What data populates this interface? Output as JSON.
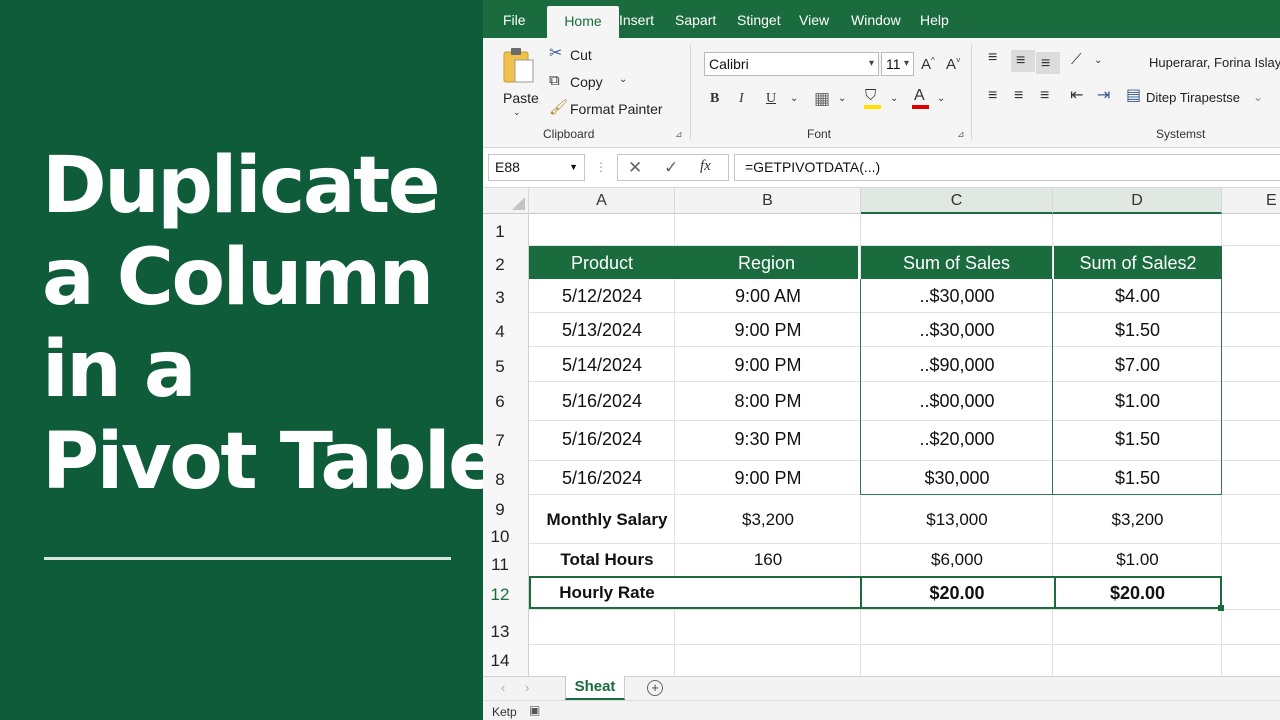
{
  "left_panel": {
    "title_lines": [
      "Duplicate",
      "a Column",
      "in a",
      "Pivot Table"
    ],
    "background_color": "#0e5c3a"
  },
  "menubar": {
    "tabs": [
      "File",
      "Home",
      "Insert",
      "Sapart",
      "Stinget",
      "View",
      "Window",
      "Help"
    ],
    "active_tab": "Home",
    "accent_color": "#1a6b3d"
  },
  "ribbon": {
    "clipboard": {
      "paste_label": "Paste",
      "cut_label": "Cut",
      "copy_label": "Copy",
      "format_painter_label": "Format Painter",
      "group_label": "Clipboard"
    },
    "font": {
      "font_name": "Calibri",
      "font_size": "11",
      "group_label": "Font",
      "grow_font": "A",
      "shrink_font": "A",
      "bold": "B",
      "italic": "I",
      "underline": "U",
      "font_color_glyph": "A",
      "highlight_color": "#ffe000",
      "font_color": "#e00000"
    },
    "alignment": {
      "wrap_text_label": "Huperarar, Forina Islay",
      "merge_label": "Ditep Tirapestse",
      "group_label": "Systemst"
    }
  },
  "formula_bar": {
    "name_box": "E88",
    "fx_label": "fx",
    "formula": "=GETPIVOTDATA(...)"
  },
  "grid": {
    "column_headers": [
      "A",
      "B",
      "C",
      "D",
      "E"
    ],
    "selected_columns": [
      "C",
      "D"
    ],
    "row_numbers": [
      "1",
      "2",
      "3",
      "4",
      "5",
      "6",
      "7",
      "8",
      "9",
      "10",
      "11",
      "12",
      "13",
      "14"
    ],
    "selected_row": "12",
    "pivot_headers": [
      "Product",
      "Region",
      "Sum of Sales",
      "Sum of Sales2"
    ],
    "pivot_rows": [
      [
        "5/12/2024",
        "9:00 AM",
        "..$30,000",
        "$4.00"
      ],
      [
        "5/13/2024",
        "9:00 PM",
        "..$30,000",
        "$1.50"
      ],
      [
        "5/14/2024",
        "9:00 PM",
        "..$90,000",
        "$7.00"
      ],
      [
        "5/16/2024",
        "8:00 PM",
        "..$00,000",
        "$1.00"
      ],
      [
        "5/16/2024",
        "9:30 PM",
        "..$20,000",
        "$1.50"
      ],
      [
        "5/16/2024",
        "9:00 PM",
        "$30,000",
        "$1.50"
      ]
    ],
    "summary_rows": [
      [
        "Monthly Salary",
        "$3,200",
        "$13,000",
        "$3,200"
      ],
      [
        "Total Hours",
        "160",
        "$6,000",
        "$1.00"
      ],
      [
        "Hourly Rate",
        "",
        "$20.00",
        "$20.00"
      ]
    ]
  },
  "sheet_tabs": {
    "prev": "‹",
    "next": "›",
    "active_sheet": "Sheat",
    "add_sheet": "+"
  },
  "status_bar": {
    "mode": "Ketp"
  }
}
